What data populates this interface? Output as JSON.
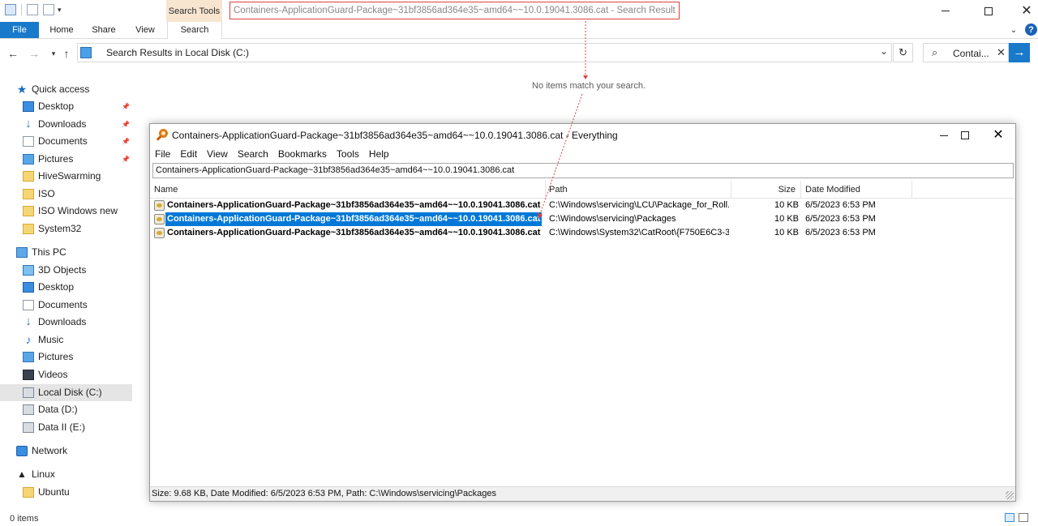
{
  "explorer": {
    "title": "Containers-ApplicationGuard-Package~31bf3856ad364e35~amd64~~10.0.19041.3086.cat - Search Result",
    "contextual_tab_group": "Search Tools",
    "ribbon_tabs": [
      "File",
      "Home",
      "Share",
      "View",
      "Search"
    ],
    "address": "Search Results in Local Disk (C:)",
    "search_value": "Contai...",
    "no_items_message": "No items match your search.",
    "status": "0 items",
    "sidebar": [
      {
        "label": "Quick access",
        "icon": "star-icon"
      },
      {
        "label": "Desktop",
        "icon": "desktop-icon",
        "pinned": true
      },
      {
        "label": "Downloads",
        "icon": "download-icon",
        "pinned": true
      },
      {
        "label": "Documents",
        "icon": "documents-icon",
        "pinned": true
      },
      {
        "label": "Pictures",
        "icon": "pictures-icon",
        "pinned": true
      },
      {
        "label": "HiveSwarming",
        "icon": "folder-icon"
      },
      {
        "label": "ISO",
        "icon": "folder-icon"
      },
      {
        "label": "ISO Windows new",
        "icon": "folder-icon"
      },
      {
        "label": "System32",
        "icon": "folder-icon"
      },
      {
        "label": "This PC",
        "icon": "computer-icon"
      },
      {
        "label": "3D Objects",
        "icon": "3d-objects-icon"
      },
      {
        "label": "Desktop",
        "icon": "desktop-icon"
      },
      {
        "label": "Documents",
        "icon": "documents-icon"
      },
      {
        "label": "Downloads",
        "icon": "download-icon"
      },
      {
        "label": "Music",
        "icon": "music-icon"
      },
      {
        "label": "Pictures",
        "icon": "pictures-icon"
      },
      {
        "label": "Videos",
        "icon": "videos-icon"
      },
      {
        "label": "Local Disk (C:)",
        "icon": "drive-icon",
        "selected": true
      },
      {
        "label": "Data (D:)",
        "icon": "drive-icon"
      },
      {
        "label": "Data II (E:)",
        "icon": "drive-icon"
      },
      {
        "label": "Network",
        "icon": "network-icon"
      },
      {
        "label": "Linux",
        "icon": "linux-icon"
      },
      {
        "label": "Ubuntu",
        "icon": "folder-icon"
      }
    ]
  },
  "everything": {
    "title": "Containers-ApplicationGuard-Package~31bf3856ad364e35~amd64~~10.0.19041.3086.cat - Everything",
    "menu": [
      "File",
      "Edit",
      "View",
      "Search",
      "Bookmarks",
      "Tools",
      "Help"
    ],
    "search_value": "Containers-ApplicationGuard-Package~31bf3856ad364e35~amd64~~10.0.19041.3086.cat",
    "columns": {
      "name": "Name",
      "path": "Path",
      "size": "Size",
      "date": "Date Modified"
    },
    "rows": [
      {
        "name": "Containers-ApplicationGuard-Package~31bf3856ad364e35~amd64~~10.0.19041.3086.cat",
        "path": "C:\\Windows\\servicing\\LCU\\Package_for_Roll...",
        "size": "10 KB",
        "date": "6/5/2023 6:53 PM",
        "selected": false
      },
      {
        "name": "Containers-ApplicationGuard-Package~31bf3856ad364e35~amd64~~10.0.19041.3086.cat",
        "path": "C:\\Windows\\servicing\\Packages",
        "size": "10 KB",
        "date": "6/5/2023 6:53 PM",
        "selected": true
      },
      {
        "name": "Containers-ApplicationGuard-Package~31bf3856ad364e35~amd64~~10.0.19041.3086.cat",
        "path": "C:\\Windows\\System32\\CatRoot\\{F750E6C3-3...",
        "size": "10 KB",
        "date": "6/5/2023 6:53 PM",
        "selected": false
      }
    ],
    "status": "Size: 9.68 KB, Date Modified: 6/5/2023 6:53 PM, Path: C:\\Windows\\servicing\\Packages"
  },
  "colors": {
    "accent": "#1979ca",
    "selection": "#0078d7",
    "annotation": "#d9413f",
    "search_tools_tab": "#f7e5d0"
  }
}
